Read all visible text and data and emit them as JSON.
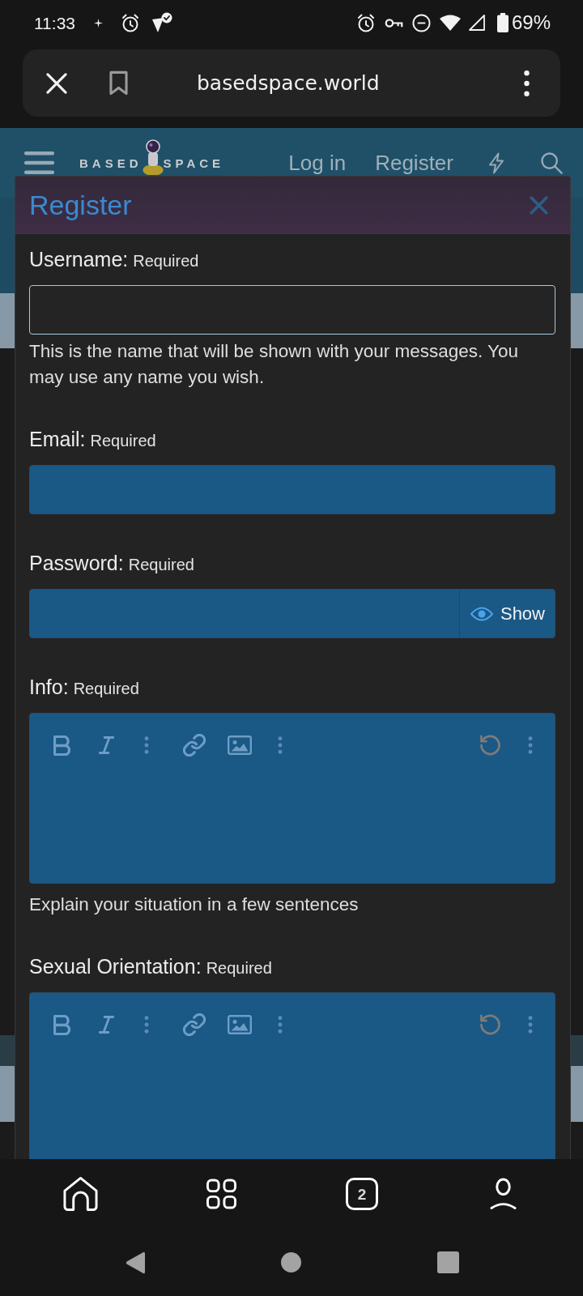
{
  "status_bar": {
    "time": "11:33",
    "battery": "69%"
  },
  "browser": {
    "url": "basedspace.world",
    "tab_count": "2"
  },
  "site_header": {
    "logo_parts": [
      "BASED",
      "SPACE"
    ],
    "links": [
      {
        "label": "Log in"
      },
      {
        "label": "Register"
      }
    ]
  },
  "dialog": {
    "title": "Register",
    "fields": [
      {
        "kind": "text",
        "label": "Username:",
        "requirement": "Required",
        "focused": true,
        "help": "This is the name that will be shown with your messages. You may use any name you wish."
      },
      {
        "kind": "text",
        "label": "Email:",
        "requirement": "Required",
        "focused": false
      },
      {
        "kind": "password",
        "label": "Password:",
        "requirement": "Required",
        "focused": false,
        "toggle": "Show"
      },
      {
        "kind": "editor",
        "label": "Info:",
        "requirement": "Required",
        "undo_disabled": true,
        "help": "Explain your situation in a few sentences"
      },
      {
        "kind": "editor",
        "label": "Sexual Orientation:",
        "requirement": "Required",
        "undo_disabled": true
      }
    ]
  }
}
